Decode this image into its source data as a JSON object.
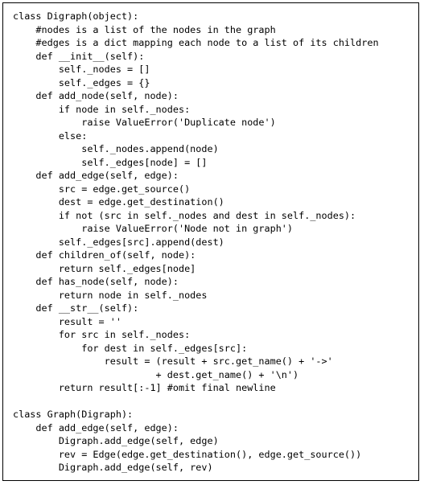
{
  "code": {
    "lines": [
      "class Digraph(object):",
      "    #nodes is a list of the nodes in the graph",
      "    #edges is a dict mapping each node to a list of its children",
      "    def __init__(self):",
      "        self._nodes = []",
      "        self._edges = {}",
      "    def add_node(self, node):",
      "        if node in self._nodes:",
      "            raise ValueError('Duplicate node')",
      "        else:",
      "            self._nodes.append(node)",
      "            self._edges[node] = []",
      "    def add_edge(self, edge):",
      "        src = edge.get_source()",
      "        dest = edge.get_destination()",
      "        if not (src in self._nodes and dest in self._nodes):",
      "            raise ValueError('Node not in graph')",
      "        self._edges[src].append(dest)",
      "    def children_of(self, node):",
      "        return self._edges[node]",
      "    def has_node(self, node):",
      "        return node in self._nodes",
      "    def __str__(self):",
      "        result = ''",
      "        for src in self._nodes:",
      "            for dest in self._edges[src]:",
      "                result = (result + src.get_name() + '->'",
      "                         + dest.get_name() + '\\n')",
      "        return result[:-1] #omit final newline",
      "",
      "class Graph(Digraph):",
      "    def add_edge(self, edge):",
      "        Digraph.add_edge(self, edge)",
      "        rev = Edge(edge.get_destination(), edge.get_source())",
      "        Digraph.add_edge(self, rev)"
    ]
  }
}
